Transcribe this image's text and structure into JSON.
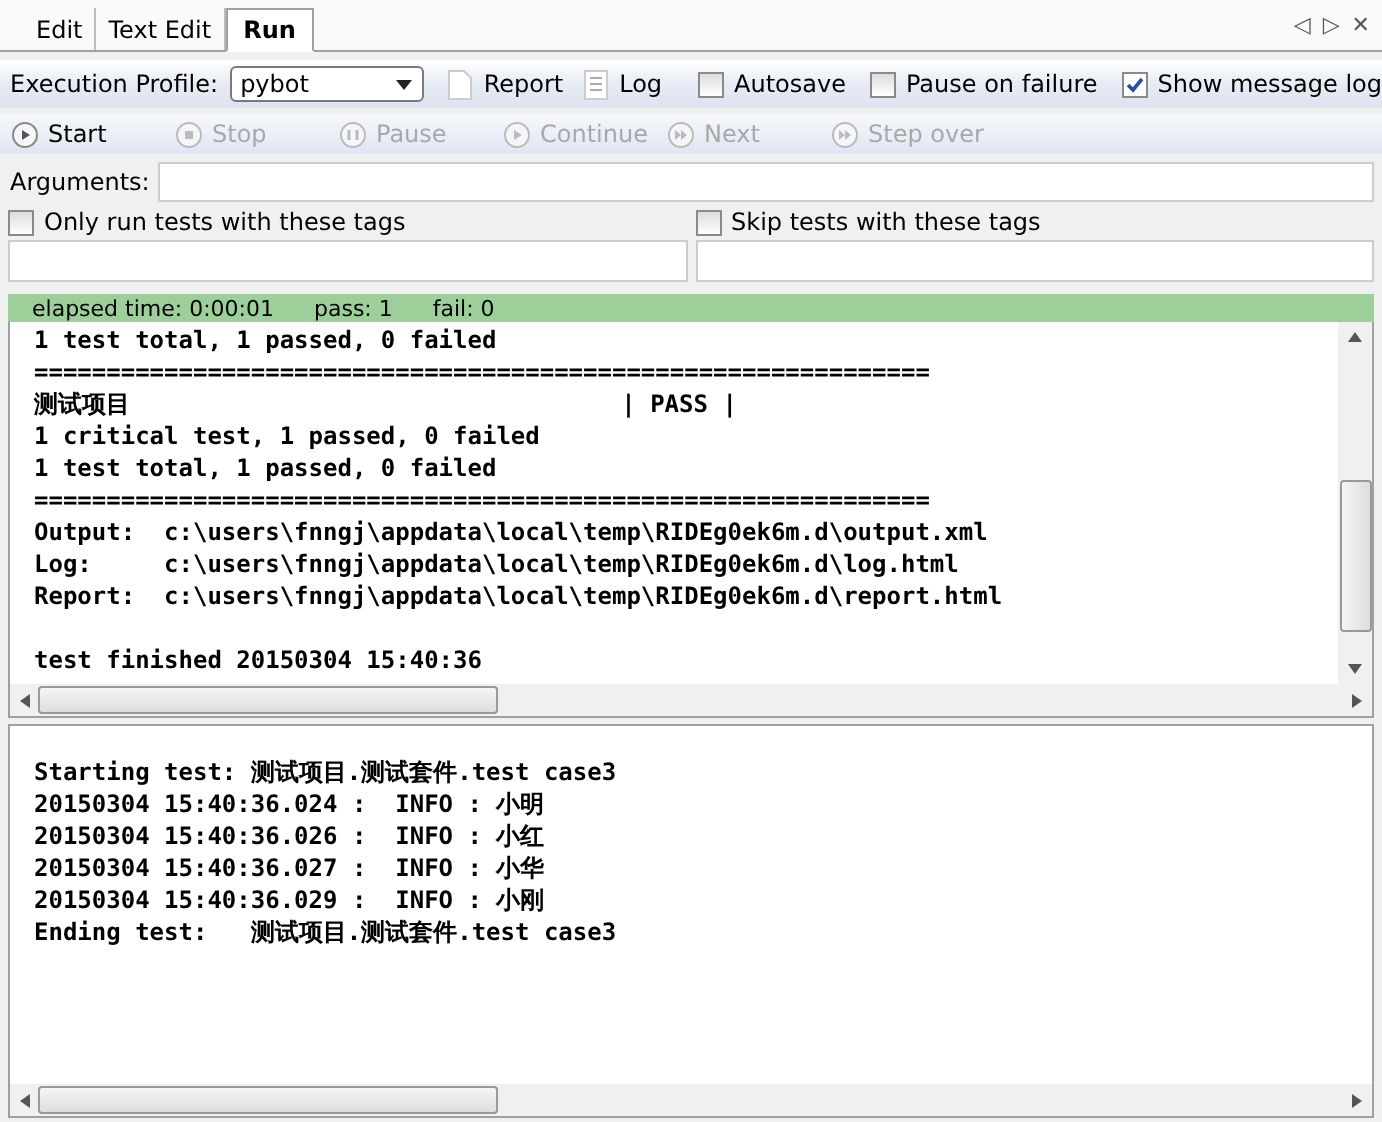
{
  "tabs": [
    {
      "label": "Edit",
      "selected": false
    },
    {
      "label": "Text Edit",
      "selected": false
    },
    {
      "label": "Run",
      "selected": true
    }
  ],
  "tab_controls": [
    "◁",
    "▷",
    "✕"
  ],
  "profile_toolbar": {
    "label": "Execution Profile:",
    "profile": "pybot",
    "report": "Report",
    "log": "Log",
    "options": [
      {
        "label": "Autosave",
        "checked": false
      },
      {
        "label": "Pause on failure",
        "checked": false
      },
      {
        "label": "Show message log",
        "checked": true
      }
    ]
  },
  "run_toolbar": [
    {
      "label": "Start",
      "kind": "play",
      "disabled": false
    },
    {
      "label": "Stop",
      "kind": "stop",
      "disabled": true
    },
    {
      "label": "Pause",
      "kind": "pause",
      "disabled": true
    },
    {
      "label": "Continue",
      "kind": "play",
      "disabled": true
    },
    {
      "label": "Next",
      "kind": "forward",
      "disabled": true
    },
    {
      "label": "Step over",
      "kind": "forward",
      "disabled": true
    }
  ],
  "arguments": {
    "label": "Arguments:"
  },
  "tag_filters": [
    {
      "label": "Only run tests with these tags",
      "checked": false
    },
    {
      "label": "Skip tests with these tags",
      "checked": false
    }
  ],
  "status_bar": {
    "elapsed": "elapsed time: 0:00:01",
    "pass": "pass: 1",
    "fail": "fail: 0"
  },
  "output_blocks": [
    {
      "lines": [
        "1 test total, 1 passed, 0 failed",
        "==============================================================",
        "测试项目                                  | PASS |",
        "1 critical test, 1 passed, 0 failed",
        "1 test total, 1 passed, 0 failed",
        "==============================================================",
        "Output:  c:\\users\\fnngj\\appdata\\local\\temp\\RIDEg0ek6m.d\\output.xml",
        "Log:     c:\\users\\fnngj\\appdata\\local\\temp\\RIDEg0ek6m.d\\log.html",
        "Report:  c:\\users\\fnngj\\appdata\\local\\temp\\RIDEg0ek6m.d\\report.html"
      ]
    },
    {
      "lines": [
        "test finished 20150304 15:40:36"
      ]
    }
  ],
  "message_log": [
    {
      "text": "Starting test: 测试项目.测试套件.test case3"
    },
    {
      "text": "20150304 15:40:36.024 :  INFO : 小明"
    },
    {
      "text": "20150304 15:40:36.026 :  INFO : 小红"
    },
    {
      "text": "20150304 15:40:36.027 :  INFO : 小华"
    },
    {
      "text": "20150304 15:40:36.029 :  INFO : 小刚"
    },
    {
      "text": "Ending test:   测试项目.测试套件.test case3"
    }
  ]
}
